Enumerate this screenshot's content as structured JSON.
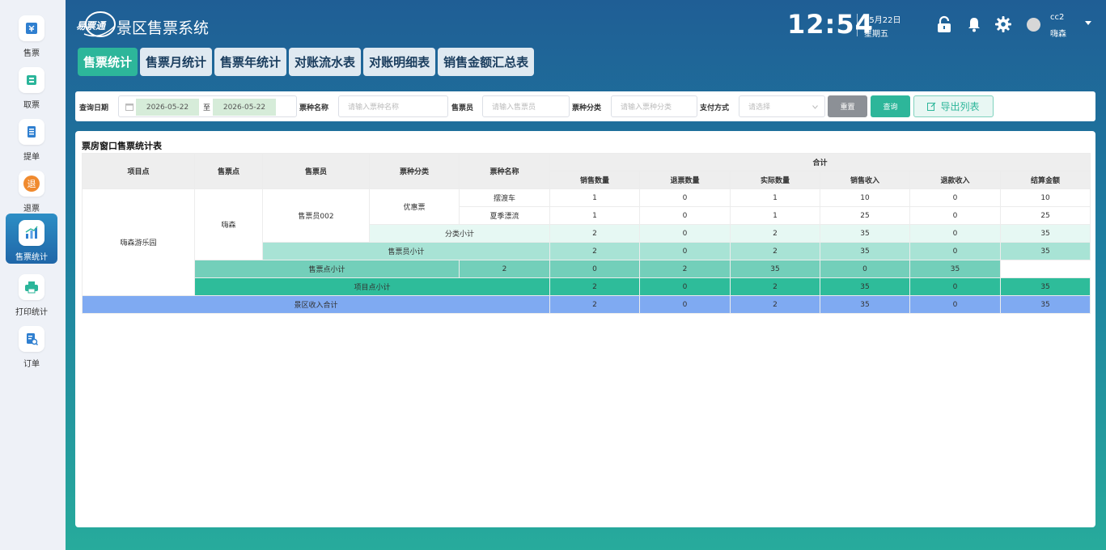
{
  "sidebar": {
    "items": [
      {
        "label": "售票",
        "icon": "ticket-icon"
      },
      {
        "label": "取票",
        "icon": "print-ticket-icon"
      },
      {
        "label": "提单",
        "icon": "document-icon"
      },
      {
        "label": "退票",
        "icon": "refund-icon",
        "icon_text": "退"
      },
      {
        "label": "售票统计",
        "icon": "stats-chart-icon",
        "active": true
      },
      {
        "label": "打印统计",
        "icon": "printer-icon"
      },
      {
        "label": "订单",
        "icon": "order-search-icon"
      }
    ]
  },
  "header": {
    "logo_text": "易票通",
    "app_title": "景区售票系统",
    "time": "12:54",
    "date": "05月22日",
    "weekday": "星期五",
    "user_name": "cc2",
    "user_org": "嗨森"
  },
  "tabs": [
    {
      "label": "售票统计",
      "active": true
    },
    {
      "label": "售票月统计"
    },
    {
      "label": "售票年统计"
    },
    {
      "label": "对账流水表"
    },
    {
      "label": "对账明细表"
    },
    {
      "label": "销售金额汇总表"
    }
  ],
  "filters": {
    "date_label": "查询日期",
    "date_from": "2026-05-22",
    "date_sep": "至",
    "date_to": "2026-05-22",
    "ticket_name_label": "票种名称",
    "ticket_name_placeholder": "请输入票种名称",
    "seller_label": "售票员",
    "seller_placeholder": "请输入售票员",
    "ticket_cat_label": "票种分类",
    "ticket_cat_placeholder": "请输入票种分类",
    "pay_label": "支付方式",
    "pay_placeholder": "请选择",
    "reset_label": "重置",
    "query_label": "查询",
    "export_label": "导出列表"
  },
  "report": {
    "title": "票房窗口售票统计表",
    "headers": {
      "project": "项目点",
      "point": "售票点",
      "seller": "售票员",
      "category": "票种分类",
      "ticket": "票种名称",
      "total": "合计",
      "sold_qty": "销售数量",
      "refund_qty": "退票数量",
      "actual_qty": "实际数量",
      "sales_income": "销售收入",
      "refund_income": "退款收入",
      "settle_amount": "结算金额"
    },
    "project": "嗨森游乐园",
    "point": "嗨森",
    "seller": "售票员002",
    "category": "优惠票",
    "rows": [
      {
        "ticket": "摆渡车",
        "v": [
          "1",
          "0",
          "1",
          "10",
          "0",
          "10"
        ]
      },
      {
        "ticket": "夏季漂流",
        "v": [
          "1",
          "0",
          "1",
          "25",
          "0",
          "25"
        ]
      }
    ],
    "category_subtotal": {
      "label": "分类小计",
      "v": [
        "2",
        "0",
        "2",
        "35",
        "0",
        "35"
      ]
    },
    "seller_subtotal": {
      "label": "售票员小计",
      "v": [
        "2",
        "0",
        "2",
        "35",
        "0",
        "35"
      ]
    },
    "point_subtotal": {
      "label": "售票点小计",
      "v": [
        "2",
        "0",
        "2",
        "35",
        "0",
        "35"
      ]
    },
    "project_subtotal": {
      "label": "项目点小计",
      "v": [
        "2",
        "0",
        "2",
        "35",
        "0",
        "35"
      ]
    },
    "grand_total": {
      "label": "景区收入合计",
      "v": [
        "2",
        "0",
        "2",
        "35",
        "0",
        "35"
      ]
    }
  },
  "colors": {
    "accent": "#2db69a",
    "sidebar_active": "#1f66a8",
    "grand_total_row": "#7faaf2"
  }
}
